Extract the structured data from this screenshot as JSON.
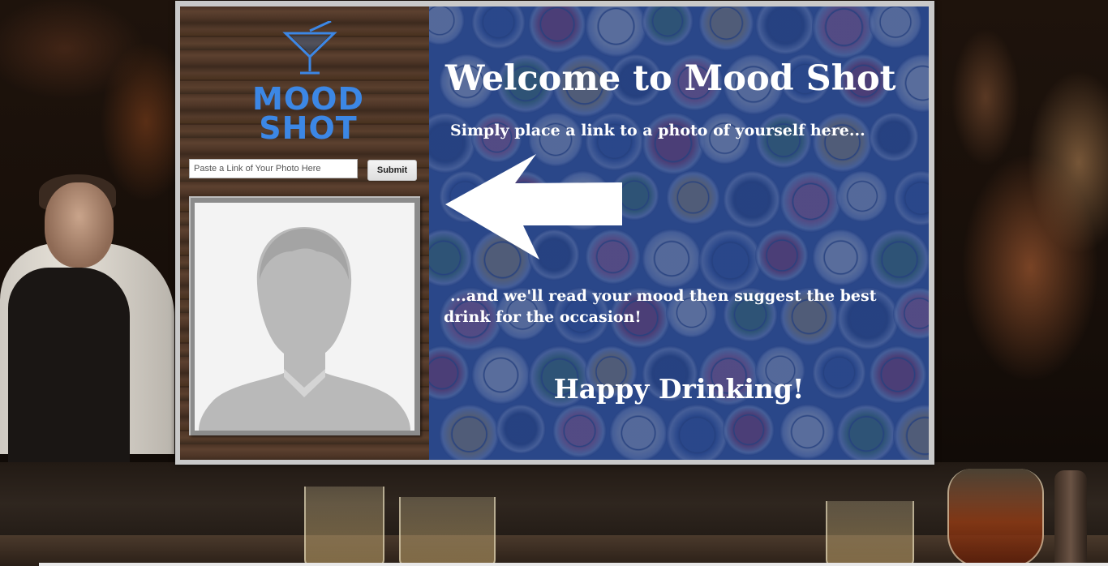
{
  "logo": {
    "line1": "MOOD",
    "line2": "SHOT",
    "icon": "martini-glass-icon",
    "color": "#3c87e5"
  },
  "form": {
    "placeholder": "Paste a Link of Your Photo Here",
    "value": "",
    "submit_label": "Submit"
  },
  "photo": {
    "icon": "avatar-placeholder-icon"
  },
  "content": {
    "title": "Welcome to Mood Shot",
    "instruction": "Simply place a link to a photo of yourself here...",
    "arrow_icon": "left-arrow-icon",
    "followup": "...and we'll read your mood then suggest the best drink for the occasion!",
    "closing": "Happy Drinking!"
  },
  "colors": {
    "panel_blue": "#2d4a86",
    "text": "#ffffff",
    "frame": "#c9c9c9"
  }
}
